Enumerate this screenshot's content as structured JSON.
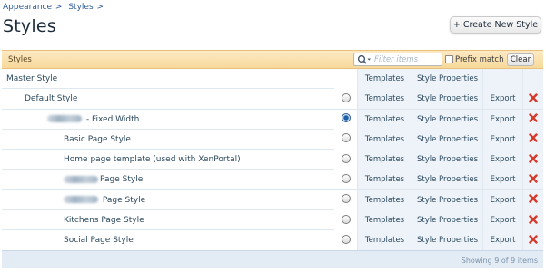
{
  "breadcrumb": [
    {
      "label": "Appearance",
      "sep": ">"
    },
    {
      "label": "Styles",
      "sep": ">"
    }
  ],
  "page": {
    "title": "Styles",
    "create_button": "+ Create New Style"
  },
  "list": {
    "header_label": "Styles",
    "filter_placeholder": "Filter items",
    "prefix_label": "Prefix match",
    "clear_label": "Clear",
    "footer_text": "Showing 9 of 9 items"
  },
  "rows": [
    {
      "name": "Master Style",
      "templates": "Templates",
      "properties": "Style Properties",
      "export": "",
      "radio": "none",
      "delete": false
    },
    {
      "name": "Default Style",
      "templates": "Templates",
      "properties": "Style Properties",
      "export": "Export",
      "radio": "unchecked",
      "delete": true
    },
    {
      "name": " - Fixed Width",
      "templates": "Templates",
      "properties": "Style Properties",
      "export": "Export",
      "radio": "checked",
      "delete": true,
      "redacted_prefix": true
    },
    {
      "name": "Basic Page Style",
      "templates": "Templates",
      "properties": "Style Properties",
      "export": "Export",
      "radio": "unchecked",
      "delete": true
    },
    {
      "name": "Home page template (used with XenPortal)",
      "templates": "Templates",
      "properties": "Style Properties",
      "export": "Export",
      "radio": "unchecked",
      "delete": true
    },
    {
      "name": "Page Style",
      "templates": "Templates",
      "properties": "Style Properties",
      "export": "Export",
      "radio": "unchecked",
      "delete": true,
      "redacted_prefix": true
    },
    {
      "name": " Page Style",
      "templates": "Templates",
      "properties": "Style Properties",
      "export": "Export",
      "radio": "unchecked",
      "delete": true,
      "redacted_prefix": true
    },
    {
      "name": "Kitchens Page Style",
      "templates": "Templates",
      "properties": "Style Properties",
      "export": "Export",
      "radio": "unchecked",
      "delete": true
    },
    {
      "name": "Social Page Style",
      "templates": "Templates",
      "properties": "Style Properties",
      "export": "Export",
      "radio": "unchecked",
      "delete": true
    }
  ],
  "colors": {
    "header_bar": "#f7d99a",
    "link": "#2f5d96",
    "delete_red": "#d63a2a",
    "selected_radio": "#1f5fa8"
  },
  "icons": {
    "filter": "search-icon",
    "delete": "delete-icon"
  }
}
